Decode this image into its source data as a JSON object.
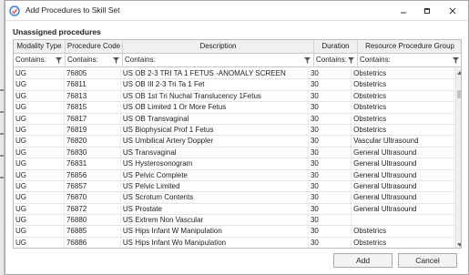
{
  "window": {
    "title": "Add Procedures to Skill Set",
    "buttons": {
      "minimize": "minimize",
      "maximize": "maximize",
      "close": "close"
    }
  },
  "section_title": "Unassigned procedures",
  "grid": {
    "columns": [
      "Modality Type",
      "Procedure Code",
      "Description",
      "Duration",
      "Resource Procedure Group"
    ],
    "filters": [
      "Contains:",
      "Contains:",
      "Contains:",
      "Contains:",
      "Contains:"
    ],
    "rows": [
      [
        "UG",
        "76805",
        "US OB 2-3 TRI TA 1 FETUS -ANOMALY SCREEN",
        "30",
        "Obstetrics"
      ],
      [
        "UG",
        "76811",
        "US OB III 2-3 Tri Ta 1 Fet",
        "30",
        "Obstetrics"
      ],
      [
        "UG",
        "76813",
        "US OB 1st Tri Nuchal Translucency 1Fetus",
        "30",
        "Obstetrics"
      ],
      [
        "UG",
        "76815",
        "US OB Limited 1 Or More Fetus",
        "30",
        "Obstetrics"
      ],
      [
        "UG",
        "76817",
        "US OB Transvaginal",
        "30",
        "Obstetrics"
      ],
      [
        "UG",
        "76819",
        "US Biophysical Prof 1 Fetus",
        "30",
        "Obstetrics"
      ],
      [
        "UG",
        "76820",
        "US Umbilical Artery Doppler",
        "30",
        "Vascular Ultrasound"
      ],
      [
        "UG",
        "76830",
        "US Transvaginal",
        "30",
        "General Ultrasound"
      ],
      [
        "UG",
        "76831",
        "US Hysterosonogram",
        "30",
        "General Ultrasound"
      ],
      [
        "UG",
        "76856",
        "US Pelvic Complete",
        "30",
        "General Ultrasound"
      ],
      [
        "UG",
        "76857",
        "US Pelvic Limited",
        "30",
        "General Ultrasound"
      ],
      [
        "UG",
        "76870",
        "US Scrotum Contents",
        "30",
        "General Ultrasound"
      ],
      [
        "UG",
        "76872",
        "US Prostate",
        "30",
        "General Ultrasound"
      ],
      [
        "UG",
        "76880",
        "US Extrem Non Vascular",
        "30",
        ""
      ],
      [
        "UG",
        "76885",
        "US Hips Infant W Manipulation",
        "30",
        "Obstetrics"
      ],
      [
        "UG",
        "76886",
        "US Hips Infant Wo Manipulation",
        "30",
        "Obstetrics"
      ]
    ]
  },
  "footer": {
    "add_label": "Add",
    "cancel_label": "Cancel"
  },
  "colors": {
    "app_icon": "#3a7bd5",
    "header_bg": "#f0f0f0",
    "border": "#bcbcbc"
  }
}
